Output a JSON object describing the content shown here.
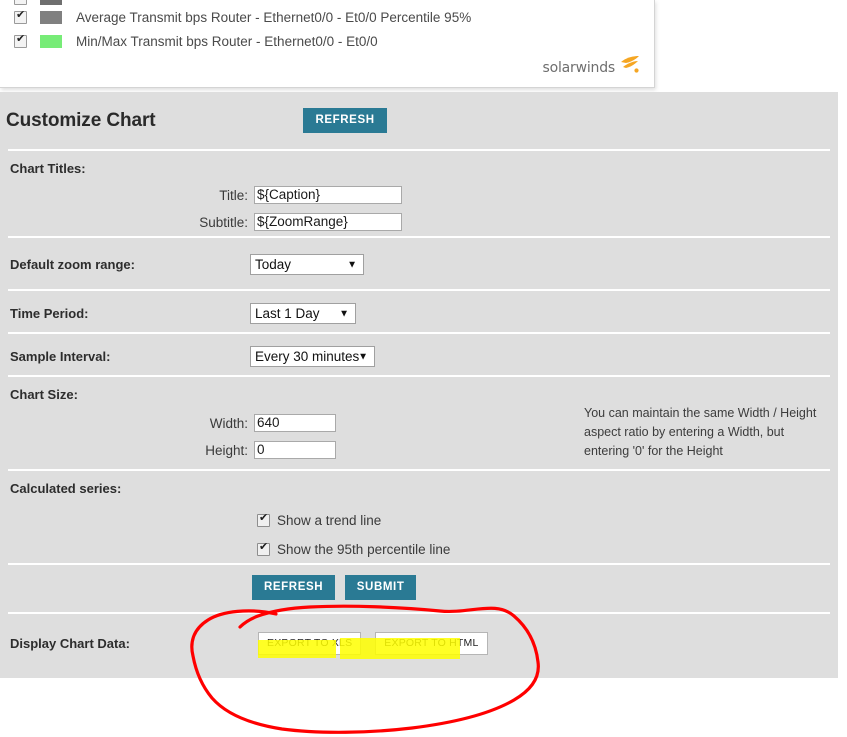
{
  "legend": {
    "rows": [
      {
        "checked": true,
        "swatch": "#6f6f6f",
        "label": ""
      },
      {
        "checked": true,
        "swatch": "#808080",
        "label": "Average Transmit bps Router - Ethernet0/0 - Et0/0 Percentile 95%"
      },
      {
        "checked": true,
        "swatch": "#77ec77",
        "label": "Min/Max Transmit bps Router - Ethernet0/0 - Et0/0"
      }
    ],
    "brand": "solarwinds"
  },
  "panel": {
    "title": "Customize Chart",
    "refresh_top_label": "REFRESH"
  },
  "chart_titles": {
    "section_label": "Chart Titles:",
    "title_label": "Title:",
    "title_value": "${Caption}",
    "subtitle_label": "Subtitle:",
    "subtitle_value": "${ZoomRange}"
  },
  "default_zoom_range": {
    "label": "Default zoom range:",
    "value": "Today",
    "arrow": "▼"
  },
  "time_period": {
    "label": "Time Period:",
    "value": "Last 1 Day",
    "arrow": "▼"
  },
  "sample_interval": {
    "label": "Sample Interval:",
    "value": "Every 30 minutes",
    "arrow": "▼"
  },
  "chart_size": {
    "section_label": "Chart Size:",
    "width_label": "Width:",
    "width_value": "640",
    "height_label": "Height:",
    "height_value": "0",
    "helper_line1": "You can maintain the same Width / Height",
    "helper_line2": "aspect ratio by entering a Width, but",
    "helper_line3": "entering '0' for the Height"
  },
  "calculated_series": {
    "section_label": "Calculated series:",
    "trend_line_label": "Show a trend line",
    "trend_line_checked": true,
    "percentile_label": "Show the 95th percentile line",
    "percentile_checked": true
  },
  "actions": {
    "refresh_label": "REFRESH",
    "submit_label": "SUBMIT"
  },
  "display_chart_data": {
    "section_label": "Display Chart Data:",
    "export_xls_label": "EXPORT TO XLS",
    "export_html_label": "EXPORT TO HTML"
  },
  "annotations": {
    "highlight_color": "#ffff00",
    "circle_color": "#ff0000"
  },
  "colors": {
    "panel_background": "#dedede",
    "accent_teal": "#2a7a94",
    "divider": "#ffffff"
  }
}
